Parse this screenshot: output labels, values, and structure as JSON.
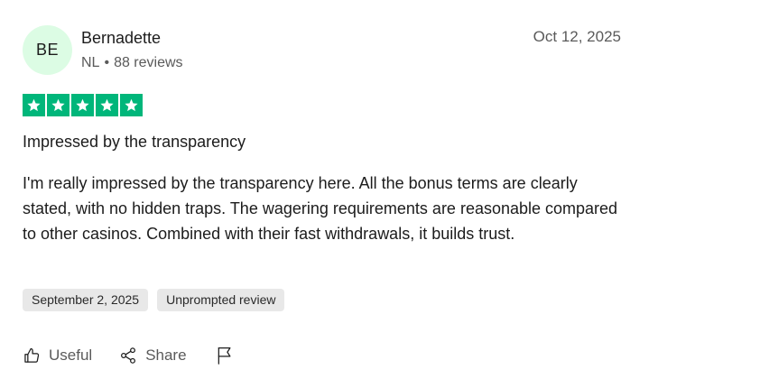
{
  "reviewer": {
    "initials": "BE",
    "name": "Bernadette",
    "country": "NL",
    "separator": "•",
    "review_count": "88 reviews"
  },
  "review": {
    "date": "Oct 12, 2025",
    "rating": 5,
    "max_rating": 5,
    "title": "Impressed by the transparency",
    "body": "I'm really impressed by the transparency here. All the bonus terms are clearly stated, with no hidden traps. The wagering requirements are reasonable compared to other casinos. Combined with their fast withdrawals, it builds trust."
  },
  "tags": [
    {
      "label": "September 2, 2025"
    },
    {
      "label": "Unprompted review"
    }
  ],
  "actions": {
    "useful_label": "Useful",
    "share_label": "Share",
    "flag_icon": "flag-icon"
  },
  "colors": {
    "star_green": "#00b67a",
    "avatar_bg": "#dcfce4",
    "tag_bg": "#e8e8e8",
    "muted_text": "#5a5a5a"
  }
}
